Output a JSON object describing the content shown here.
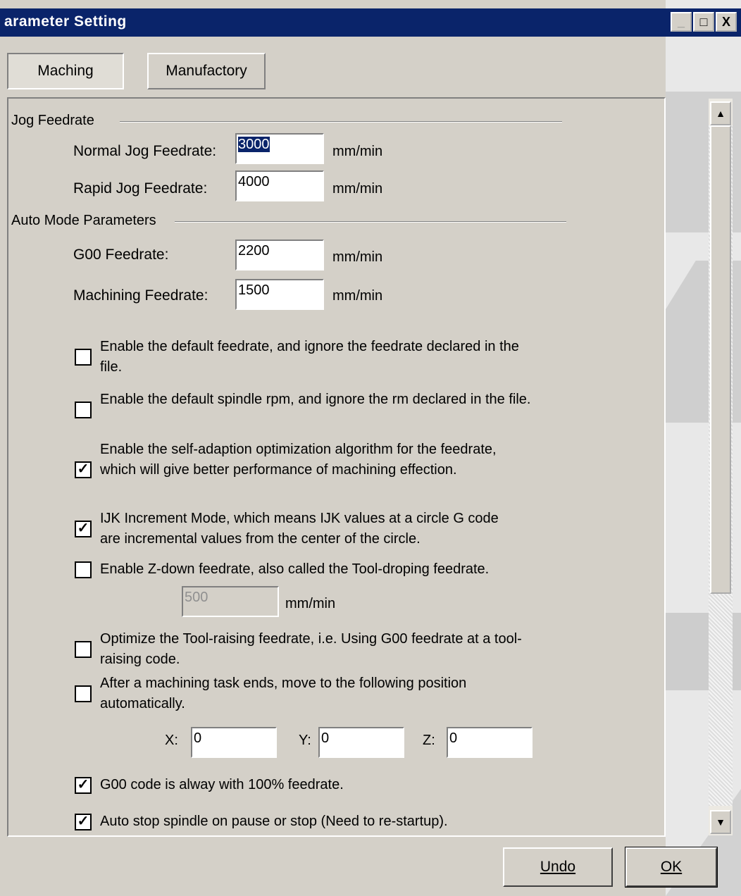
{
  "window": {
    "title": "arameter Setting"
  },
  "title_buttons": {
    "minimize": "_",
    "maximize": "□",
    "close": "X"
  },
  "tabs": [
    {
      "label": "Maching"
    },
    {
      "label": "Manufactory"
    }
  ],
  "jog": {
    "group_label": "Jog Feedrate",
    "normal_label": "Normal Jog Feedrate:",
    "normal_value": "3000",
    "rapid_label": "Rapid Jog Feedrate:",
    "rapid_value": "4000",
    "unit": "mm/min"
  },
  "auto": {
    "group_label": "Auto Mode Parameters",
    "g00_label": "G00 Feedrate:",
    "g00_value": "2200",
    "mach_label": "Machining Feedrate:",
    "mach_value": "1500",
    "unit": "mm/min"
  },
  "options": [
    {
      "text": "Enable the default feedrate, and ignore the feedrate declared in the file.",
      "checked": false
    },
    {
      "text": "Enable the default spindle rpm, and ignore the rm declared in the file.",
      "checked": false
    },
    {
      "text": "Enable the self-adaption optimization algorithm for the feedrate, which will give better performance of machining effection.",
      "checked": true
    },
    {
      "text": "IJK Increment Mode, which means IJK values at a circle G code are incremental values from the center of the circle.",
      "checked": true
    },
    {
      "text": "Enable Z-down feedrate, also called the Tool-droping feedrate.",
      "checked": false
    },
    {
      "text": "Optimize the Tool-raising feedrate, i.e. Using G00 feedrate at a tool-raising code.",
      "checked": false
    },
    {
      "text": "After a machining task ends, move to the following position automatically.",
      "checked": false
    },
    {
      "text": "G00 code is alway with 100% feedrate.",
      "checked": true
    },
    {
      "text": "Auto stop spindle on pause or stop (Need to re-startup).",
      "checked": true
    }
  ],
  "zdown": {
    "value": "500",
    "unit": "mm/min"
  },
  "position": {
    "x_label": "X:",
    "x_value": "0",
    "y_label": "Y:",
    "y_value": "0",
    "z_label": "Z:",
    "z_value": "0"
  },
  "buttons": {
    "undo": "Undo",
    "ok": "OK"
  },
  "checkmark": "✓",
  "scroll_arrows": {
    "up": "▲",
    "down": "▼"
  }
}
